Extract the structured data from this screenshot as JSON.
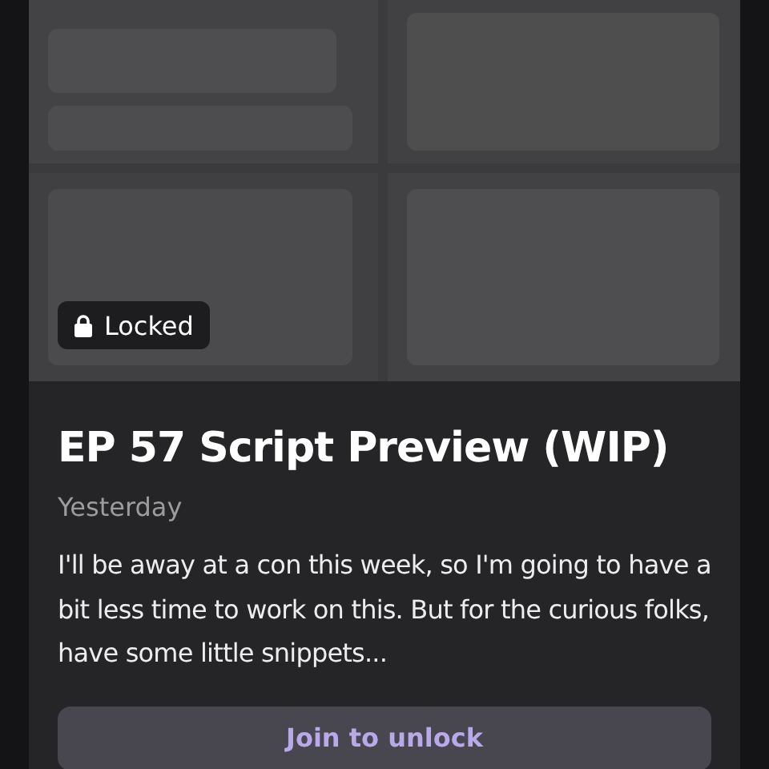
{
  "preview": {
    "kind": "picture",
    "badge": {
      "label": "Locked",
      "locked": true
    }
  },
  "post": {
    "title": "EP 57 Script Preview (WIP)",
    "date": "Yesterday",
    "body": "I'll be away at a con this week, so I'm going to have a bit less time to work on this. But for the curious folks, have some little snippets...",
    "button": "Join to unlock"
  }
}
